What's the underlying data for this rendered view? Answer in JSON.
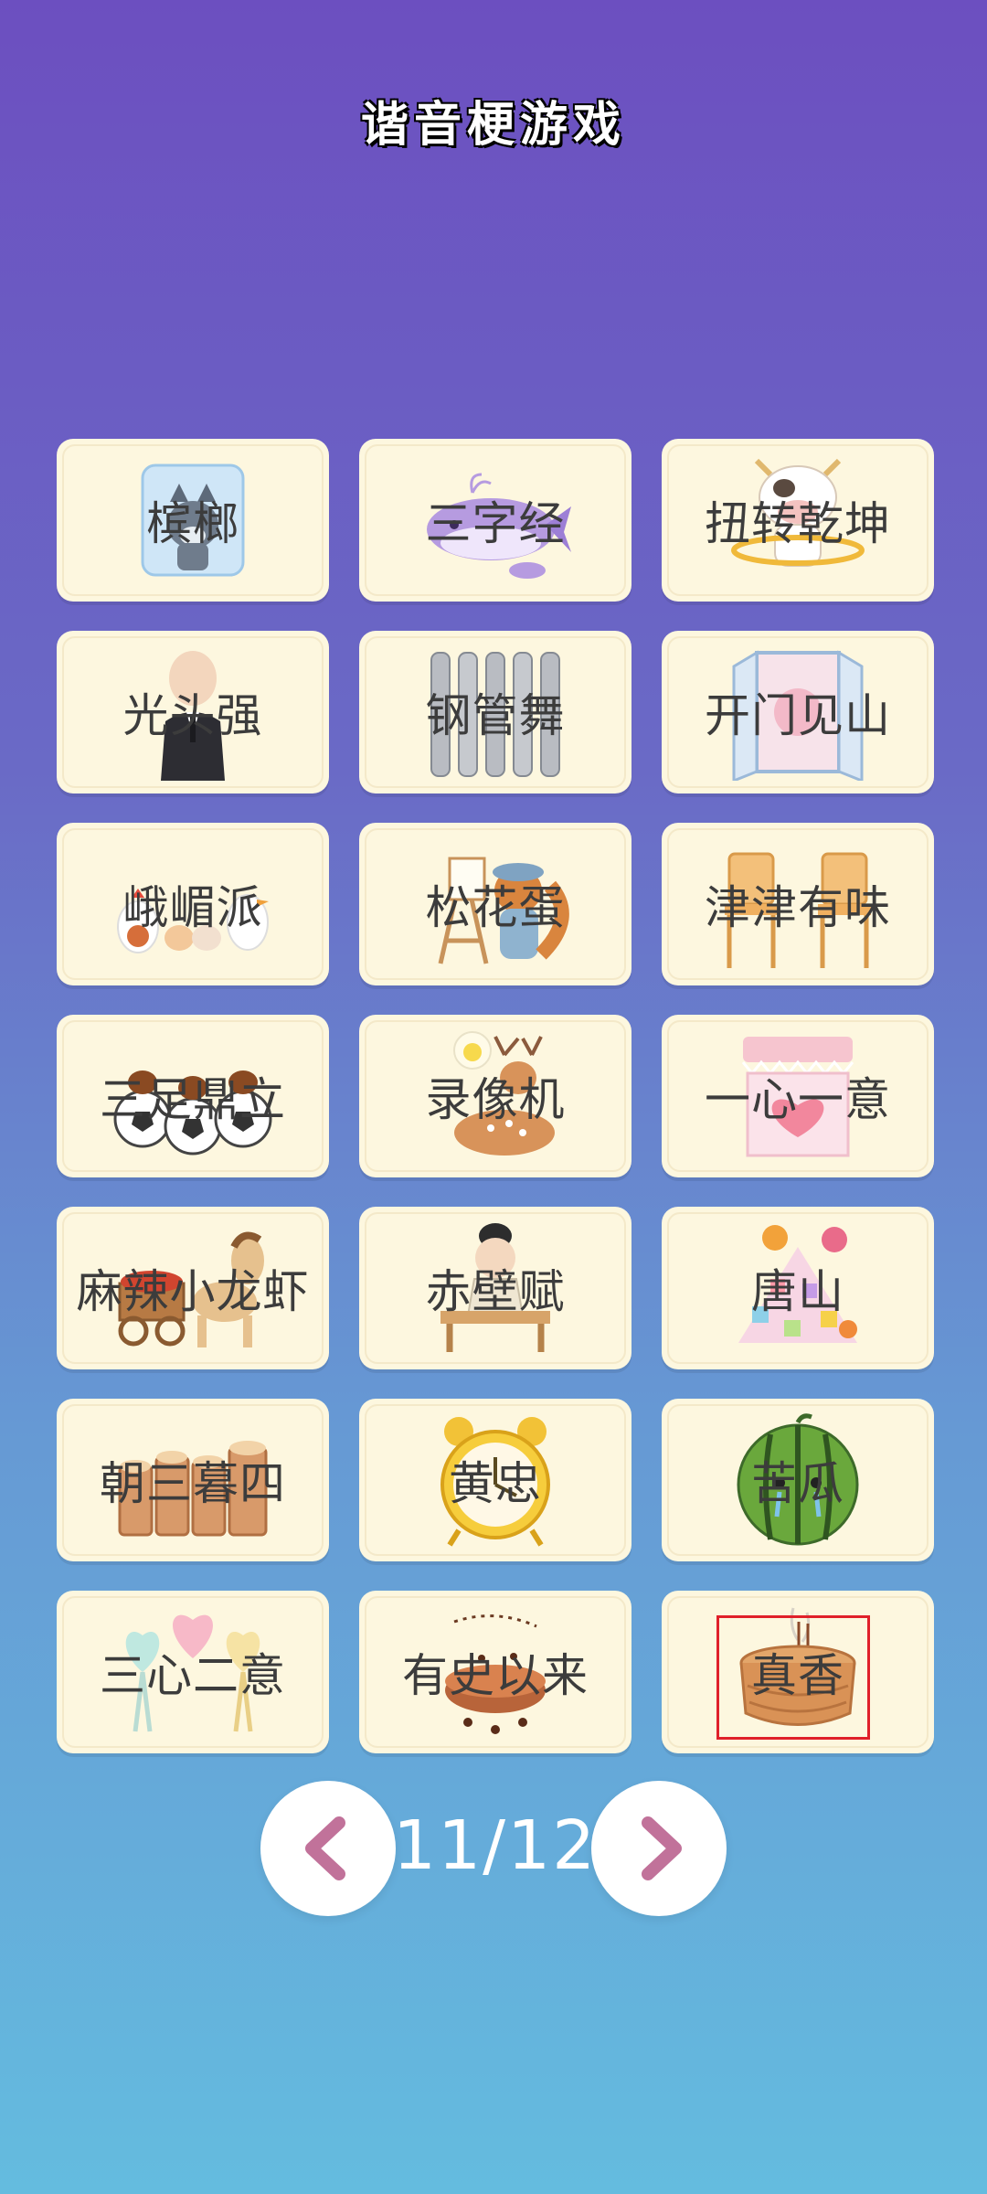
{
  "header": {
    "title": "谐音梗游戏"
  },
  "grid": {
    "cards": [
      {
        "label": "槟榔",
        "icon": "ice-cube-wolf-icon"
      },
      {
        "label": "三字经",
        "icon": "whale-icon"
      },
      {
        "label": "扭转乾坤",
        "icon": "cow-hula-hoop-icon"
      },
      {
        "label": "光头强",
        "icon": "bald-man-suit-icon"
      },
      {
        "label": "钢管舞",
        "icon": "steel-pipes-icon"
      },
      {
        "label": "开门见山",
        "icon": "open-door-icon"
      },
      {
        "label": "峨嵋派",
        "icon": "chicken-cat-goose-icon"
      },
      {
        "label": "松花蛋",
        "icon": "squirrel-painter-icon"
      },
      {
        "label": "津津有味",
        "icon": "chairs-icon"
      },
      {
        "label": "三足鼎立",
        "icon": "chestnut-footballs-icon"
      },
      {
        "label": "录像机",
        "icon": "deer-chick-icon"
      },
      {
        "label": "一心一意",
        "icon": "heart-shop-icon"
      },
      {
        "label": "麻辣小龙虾",
        "icon": "horse-cart-icon"
      },
      {
        "label": "赤壁赋",
        "icon": "scholar-desk-icon"
      },
      {
        "label": "唐山",
        "icon": "candy-pile-icon"
      },
      {
        "label": "朝三暮四",
        "icon": "tree-stumps-icon"
      },
      {
        "label": "黄忠",
        "icon": "alarm-clock-icon"
      },
      {
        "label": "苦瓜",
        "icon": "crying-watermelon-icon"
      },
      {
        "label": "三心二意",
        "icon": "heart-chairs-icon"
      },
      {
        "label": "有史以来",
        "icon": "ants-cake-icon"
      },
      {
        "label": "真香",
        "icon": "incense-burner-icon"
      }
    ]
  },
  "pager": {
    "page_text": "11/12",
    "prev_icon": "chevron-left-icon",
    "next_icon": "chevron-right-icon",
    "arrow_color": "#c1729a"
  },
  "colors": {
    "bg_top": "#6c4fc0",
    "bg_bottom": "#64bcdf",
    "card": "#fdf7df",
    "highlight": "#e0202a"
  }
}
